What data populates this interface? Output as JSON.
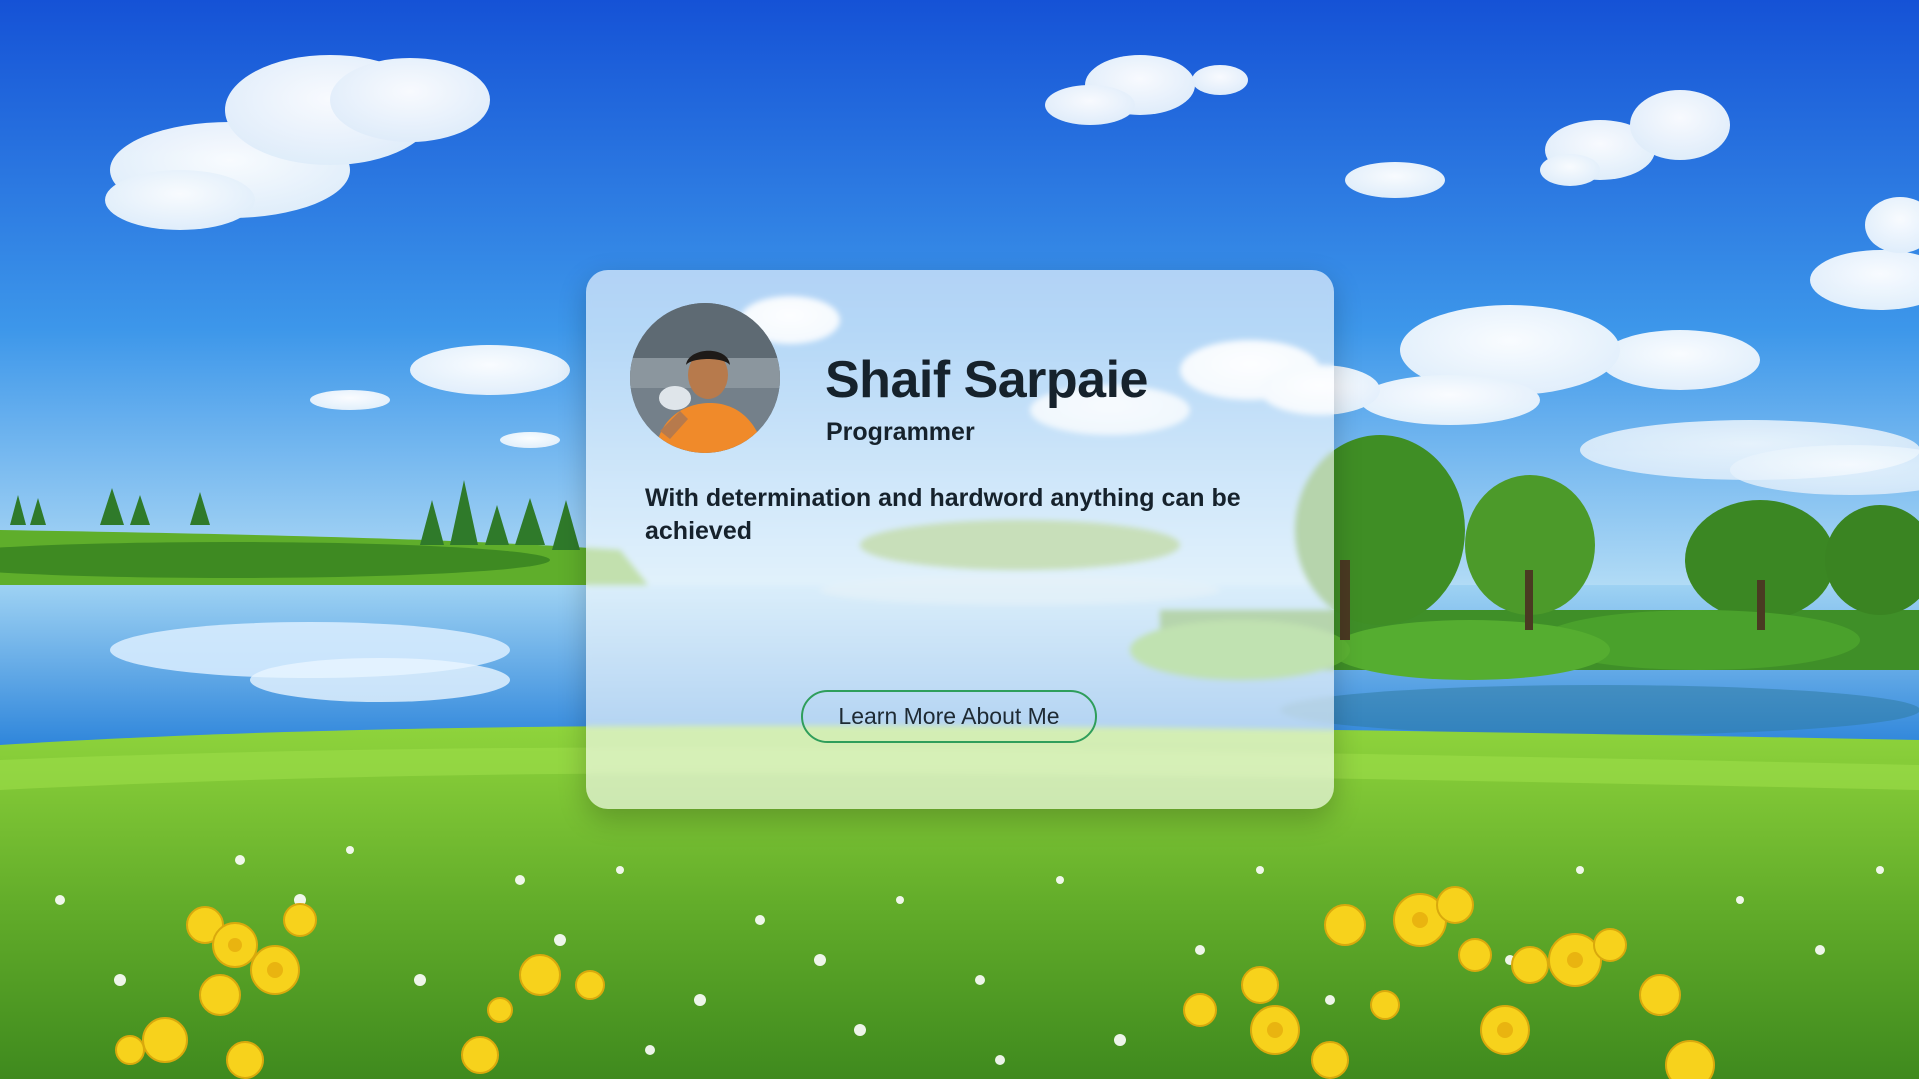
{
  "profile": {
    "name": "Shaif Sarpaie",
    "role": "Programmer",
    "quote": "With determination and hardword anything can be achieved",
    "cta_label": "Learn More About Me"
  },
  "colors": {
    "sky_top": "#1d5fd6",
    "sky_bottom": "#9fd0f2",
    "water": "#4aa3e6",
    "grass": "#7cc43a",
    "flower": "#f6d31a",
    "button_border": "#2f9e5b",
    "text": "#16222c"
  },
  "icons": {
    "avatar": "profile-photo"
  }
}
